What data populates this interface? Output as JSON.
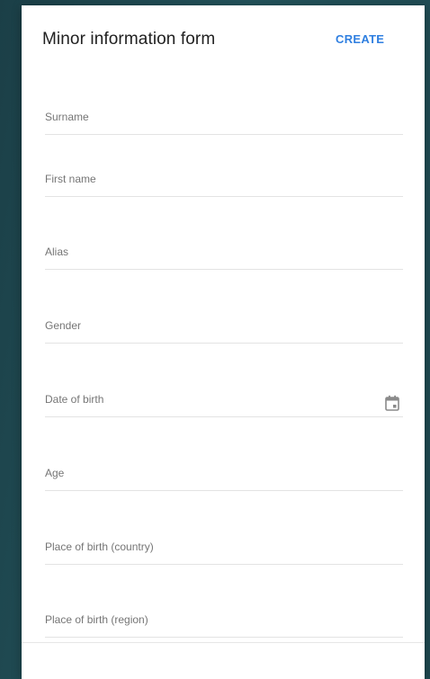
{
  "dialog": {
    "title": "Minor information form",
    "create_label": "CREATE"
  },
  "fields": {
    "surname": "Surname",
    "first_name": "First name",
    "alias": "Alias",
    "gender": "Gender",
    "date_of_birth": "Date of birth",
    "age": "Age",
    "place_of_birth_country": "Place of birth (country)",
    "place_of_birth_region": "Place of birth (region)"
  },
  "icons": {
    "date_of_birth_picker": "calendar-icon"
  },
  "colors": {
    "accent": "#2f7fe0",
    "background": "#1f4a52",
    "title_text": "#212121",
    "label_text": "#757575",
    "underline": "#e3e3e3"
  }
}
